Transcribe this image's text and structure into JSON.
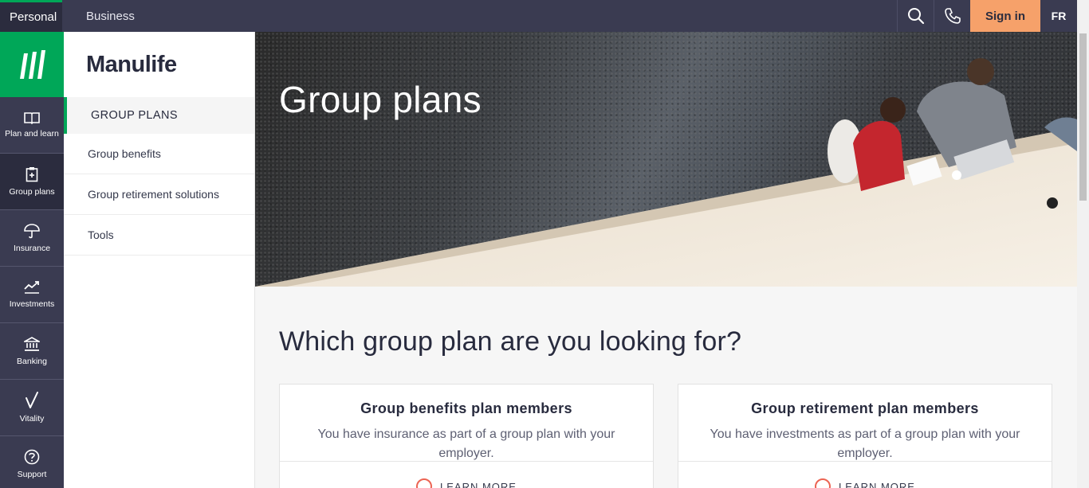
{
  "topbar": {
    "personal_label": "Personal",
    "business_label": "Business",
    "search_icon": "search-icon",
    "phone_icon": "phone-icon",
    "signin_label": "Sign in",
    "lang_label": "FR",
    "colors": {
      "bar": "#3a3b51",
      "signin": "#f6a16a",
      "accent": "#00a758"
    }
  },
  "rail": {
    "items": [
      {
        "label": "Plan and learn",
        "icon": "book-icon"
      },
      {
        "label": "Group plans",
        "icon": "clipboard-icon"
      },
      {
        "label": "Insurance",
        "icon": "umbrella-icon"
      },
      {
        "label": "Investments",
        "icon": "chart-icon"
      },
      {
        "label": "Banking",
        "icon": "bank-icon"
      },
      {
        "label": "Vitality",
        "icon": "vitality-icon"
      },
      {
        "label": "Support",
        "icon": "question-icon"
      }
    ]
  },
  "sidenav": {
    "brand": "Manulife",
    "section_title": "GROUP PLANS",
    "links": [
      "Group benefits",
      "Group retirement solutions",
      "Tools"
    ]
  },
  "hero": {
    "title": "Group plans"
  },
  "main": {
    "heading": "Which group plan are you looking for?",
    "cards": [
      {
        "title": "Group benefits plan members",
        "text": "You have insurance as part of a group plan with your employer.",
        "cta": "LEARN MORE"
      },
      {
        "title": "Group retirement plan members",
        "text": "You have investments as part of a group plan with your employer.",
        "cta": "LEARN MORE"
      }
    ]
  }
}
